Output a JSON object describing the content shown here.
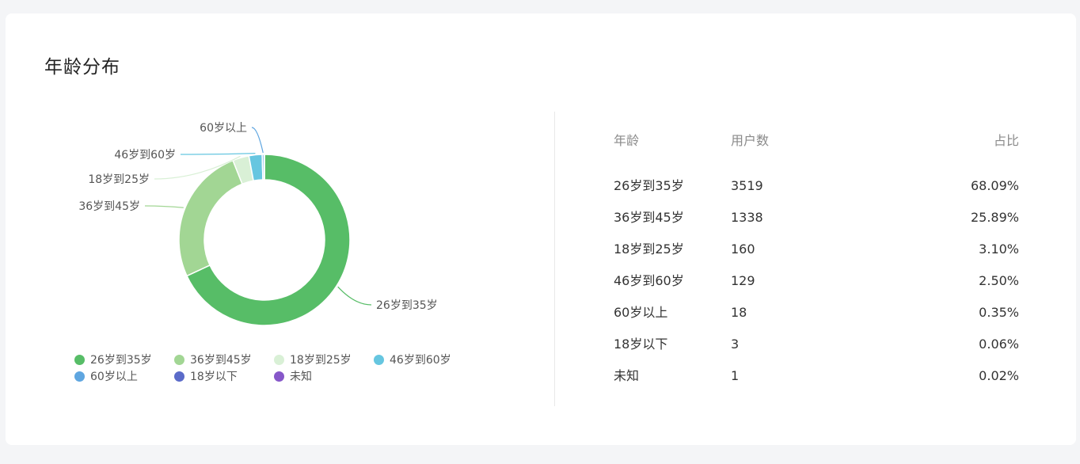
{
  "card": {
    "title": "年龄分布"
  },
  "colors": {
    "26岁到35岁": "#57bd67",
    "36岁到45岁": "#a2d694",
    "18岁到25岁": "#d9f0d6",
    "46岁到60岁": "#66c6e0",
    "60岁以上": "#5fa6e0",
    "18岁以下": "#5b6bc9",
    "未知": "#8657c9"
  },
  "table": {
    "headers": {
      "name": "年龄",
      "users": "用户数",
      "pct": "占比"
    },
    "rows": [
      {
        "name": "26岁到35岁",
        "users": "3519",
        "pct": "68.09%"
      },
      {
        "name": "36岁到45岁",
        "users": "1338",
        "pct": "25.89%"
      },
      {
        "name": "18岁到25岁",
        "users": "160",
        "pct": "3.10%"
      },
      {
        "name": "46岁到60岁",
        "users": "129",
        "pct": "2.50%"
      },
      {
        "name": "60岁以上",
        "users": "18",
        "pct": "0.35%"
      },
      {
        "name": "18岁以下",
        "users": "3",
        "pct": "0.06%"
      },
      {
        "name": "未知",
        "users": "1",
        "pct": "0.02%"
      }
    ]
  },
  "chart_data": {
    "type": "pie",
    "title": "年龄分布",
    "categories": [
      "26岁到35岁",
      "36岁到45岁",
      "18岁到25岁",
      "46岁到60岁",
      "60岁以上",
      "18岁以下",
      "未知"
    ],
    "values": [
      3519,
      1338,
      160,
      129,
      18,
      3,
      1
    ],
    "percentages": [
      68.09,
      25.89,
      3.1,
      2.5,
      0.35,
      0.06,
      0.02
    ],
    "donut": true,
    "legend_position": "bottom",
    "slice_labels": [
      "26岁到35岁",
      "36岁到45岁",
      "18岁到25岁",
      "46岁到60岁",
      "60岁以上"
    ]
  }
}
